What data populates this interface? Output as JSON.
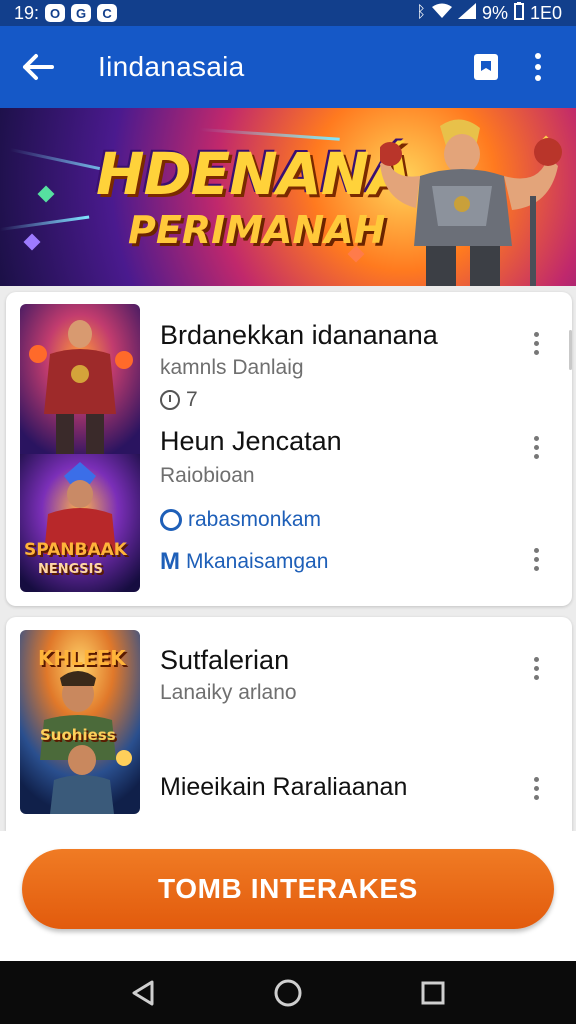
{
  "status_bar": {
    "time": "19:",
    "battery_percent": "9%",
    "right_text": "1E0",
    "icons": [
      "notification-o-icon",
      "notification-g-icon",
      "notification-c-icon",
      "bluetooth-icon",
      "wifi-icon",
      "signal-icon",
      "battery-icon"
    ]
  },
  "app_bar": {
    "title": "Iindanasaia",
    "back_icon": "arrow-left-icon",
    "actions": [
      "bookmark-icon",
      "more-vert-icon"
    ]
  },
  "banner": {
    "title": "HDENANÁ",
    "subtitle": "PERIMANAH"
  },
  "card1": {
    "thumb_caption_1": "SPANBAAK",
    "thumb_caption_2": "NENGSIS",
    "rows": [
      {
        "title": "Brdanekkan idananana",
        "subtitle": "kamnls Danlaig",
        "meta_value": "7"
      },
      {
        "title": "Heun Jencatan",
        "subtitle": "Raiobioan"
      }
    ],
    "links": [
      {
        "icon": "ring-icon",
        "label": "rabasmonkam"
      },
      {
        "icon": "m-logo-icon",
        "label": "Mkanaisamgan"
      }
    ]
  },
  "card2": {
    "thumb_caption_1": "KHLEEK",
    "thumb_caption_2": "Suohiess",
    "rows": [
      {
        "title": "Sutfalerian",
        "subtitle": "Lanaiky arlano"
      },
      {
        "title": "Mieeikain Raraliaanan"
      }
    ]
  },
  "cta": {
    "label": "TOMB INTERAKES"
  },
  "colors": {
    "app_bar": "#1558c7",
    "status_bar": "#123f8c",
    "cta": "#e8661a",
    "link": "#1e5fb8"
  },
  "nav_bar": {
    "icons": [
      "back-triangle-icon",
      "home-circle-icon",
      "recents-square-icon"
    ]
  }
}
